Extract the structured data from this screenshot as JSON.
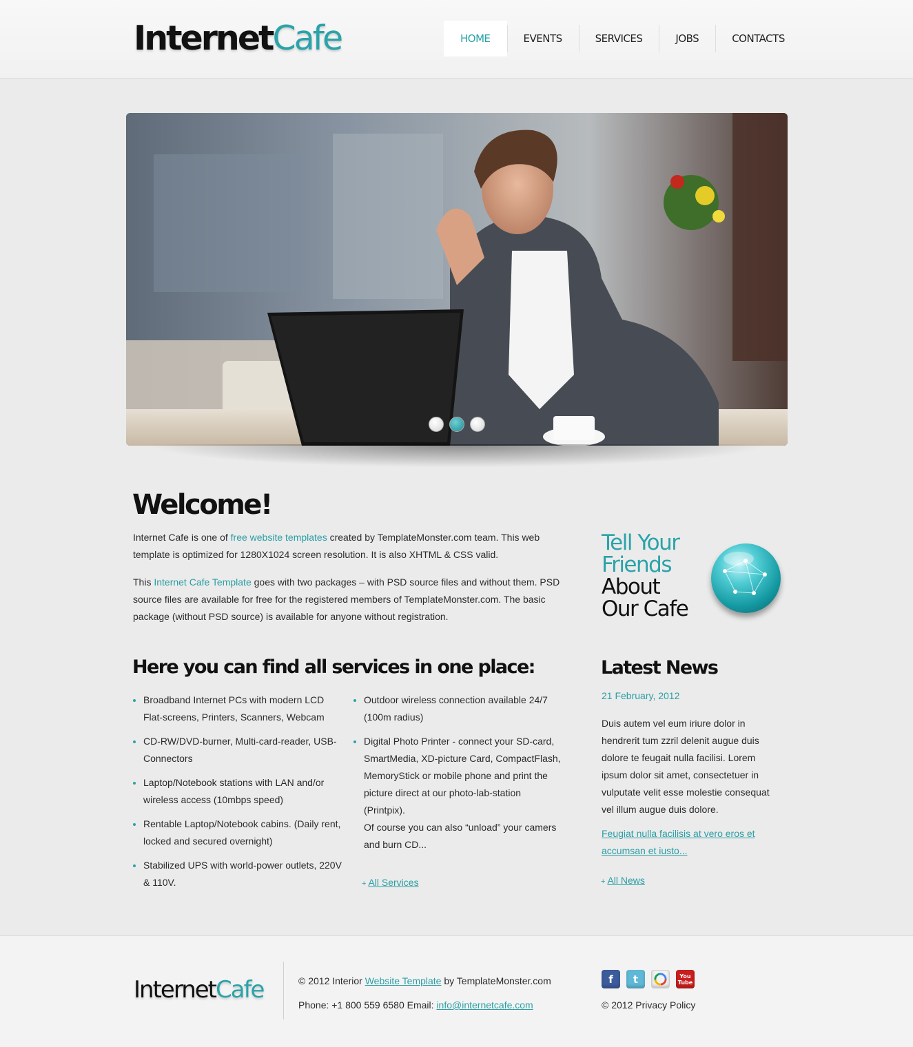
{
  "header": {
    "logo_part1": "Internet",
    "logo_part2": "Cafe",
    "nav": [
      {
        "label": "HOME"
      },
      {
        "label": "EVENTS"
      },
      {
        "label": "SERVICES"
      },
      {
        "label": "JOBS"
      },
      {
        "label": "CONTACTS"
      }
    ],
    "active_nav": "HOME"
  },
  "slider": {
    "active_slide": 2,
    "slide_count": 3
  },
  "welcome": {
    "title": "Welcome!",
    "p1_a": "Internet Cafe is one of ",
    "p1_link": "free website templates",
    "p1_b": " created by TemplateMonster.com team. This web template is optimized for 1280X1024 screen resolution. It is also XHTML & CSS valid.",
    "p2_a": "This ",
    "p2_link": "Internet Cafe Template",
    "p2_b": " goes with two packages – with PSD source files and without them. PSD source files are available for free for the registered members of TemplateMonster.com. The basic package (without PSD source) is available for anyone without registration."
  },
  "tell": {
    "line1": "Tell Your",
    "line2": "Friends",
    "line3": "About",
    "line4": "Our Cafe"
  },
  "services": {
    "title": "Here you can find all services in one place:",
    "col1": [
      "Broadband Internet PCs with modern LCD Flat-screens, Printers, Scanners, Webcam",
      "CD-RW/DVD-burner, Multi-card-reader, USB-Connectors",
      "Laptop/Notebook stations with LAN and/or wireless access (10mbps speed)",
      "Rentable Laptop/Notebook cabins. (Daily rent, locked and secured overnight)",
      "Stabilized UPS with world-power outlets, 220V & 110V."
    ],
    "col2": [
      "Outdoor wireless connection available 24/7 (100m radius)",
      "Digital Photo Printer - connect your SD-card, SmartMedia, XD-picture Card, CompactFlash, MemoryStick or mobile phone and print the picture direct at our photo-lab-station (Printpix).",
      "Of course you can also “unload” your camers and burn CD..."
    ],
    "more_plus": "+",
    "more_label": "All Services"
  },
  "news": {
    "title": "Latest News",
    "date": "21 February, 2012",
    "text": "Duis autem vel eum iriure dolor in hendrerit tum zzril delenit augue duis dolore te feugait nulla facilisi. Lorem ipsum dolor sit amet, consectetuer in vulputate velit esse molestie consequat vel illum augue duis dolore.",
    "link": "Feugiat nulla facilisis at vero eros et accumsan et iusto...",
    "more_plus": "+",
    "more_label": "All News"
  },
  "footer": {
    "logo_part1": "Internet",
    "logo_part2": "Cafe",
    "copy_a": "© 2012 Interior ",
    "copy_link": "Website Template",
    "copy_b": " by TemplateMonster.com",
    "phone_text": "Phone: +1 800 559 6580 Email: ",
    "email": "info@internetcafe.com",
    "privacy": "© 2012 Privacy Policy",
    "socials": [
      {
        "icon": "facebook-icon",
        "glyph": "f"
      },
      {
        "icon": "twitter-icon",
        "glyph": "t"
      },
      {
        "icon": "picasa-icon",
        "glyph": "✿"
      },
      {
        "icon": "youtube-icon",
        "glyph": "You Tube"
      }
    ]
  },
  "colors": {
    "accent": "#2aa3a9",
    "background": "#ebebeb",
    "text": "#2b2b2b"
  }
}
